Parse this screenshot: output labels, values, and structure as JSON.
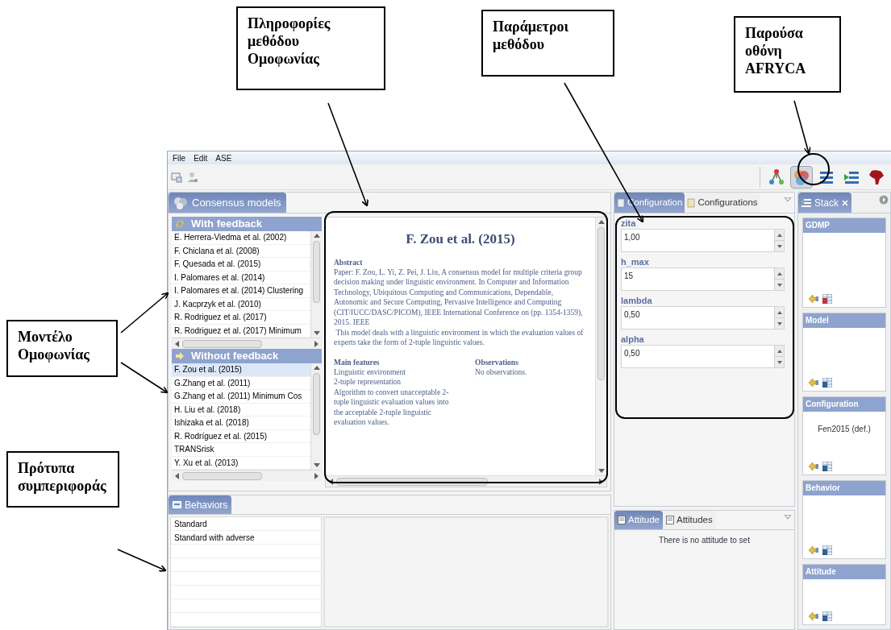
{
  "annotations": [
    {
      "text": "Πληροφορίες μεθόδου Ομοφωνίας"
    },
    {
      "text": "Παράμετροι μεθόδου"
    },
    {
      "text": "Παρούσα οθόνη AFRYCA"
    },
    {
      "text": "Μοντέλο Ομοφωνίας"
    },
    {
      "text": "Πρότυπα συμπεριφοράς"
    }
  ],
  "menu": [
    "File",
    "Edit",
    "ASE"
  ],
  "perspectives": [
    {
      "selected": false
    },
    {
      "selected": true
    },
    {
      "selected": false
    },
    {
      "selected": false
    },
    {
      "selected": false
    }
  ],
  "consensus_panel": {
    "tab": "Consensus models",
    "groups": [
      {
        "title": "With feedback",
        "items": [
          {
            "label": "E. Herrera-Viedma et al. (2002)",
            "selected": false
          },
          {
            "label": "F. Chiclana et al. (2008)",
            "selected": false
          },
          {
            "label": "F. Quesada et al. (2015)",
            "selected": false
          },
          {
            "label": "I. Palomares et al. (2014)",
            "selected": false
          },
          {
            "label": "I. Palomares et al. (2014) Clustering",
            "selected": false
          },
          {
            "label": "J. Kacprzyk et al. (2010)",
            "selected": false
          },
          {
            "label": "R. Rodriguez et al. (2017)",
            "selected": false
          },
          {
            "label": "R. Rodriguez et al. (2017) Minimum",
            "selected": false
          }
        ]
      },
      {
        "title": "Without feedback",
        "items": [
          {
            "label": "F. Zou et al. (2015)",
            "selected": true
          },
          {
            "label": "G.Zhang et al. (2011)",
            "selected": false
          },
          {
            "label": "G.Zhang et al. (2011) Minimum Cos",
            "selected": false
          },
          {
            "label": "H. Liu et al. (2018)",
            "selected": false
          },
          {
            "label": "Ishizaka et al. (2018)",
            "selected": false
          },
          {
            "label": "R. Rodríguez et al. (2015)",
            "selected": false
          },
          {
            "label": "TRANSrisk",
            "selected": false
          },
          {
            "label": "Y. Xu et al. (2013)",
            "selected": false
          }
        ]
      }
    ],
    "details": {
      "title": "F. Zou et al. (2015)",
      "abstract_heading": "Abstract",
      "abstract": [
        "Paper: F. Zou, L. Yi, Z. Pei, J. Liu, A consensus model for multiple criteria group decision making under linguistic environment. In Computer and Information Technology, Ubiquitous Computing and Communications, Dependable, Autonomic and Secure Computing, Pervasive Intelligence and Computing (CIT/IUCC/DASC/PICOM), IEEE International Conference on (pp. 1354-1359), 2015. IEEE",
        " This model deals with a linguistic environment in which the evaluation values of experts take the form of 2-tuple linguistic values."
      ],
      "features_heading": "Main features",
      "features": [
        "Linguistic environment",
        "2-tuple representation",
        "Algorithm to convert unacceptable 2-tuple linguistic evaluation values into the acceptable 2-tuple linguistic evaluation values."
      ],
      "observations_heading": "Observations",
      "observations": "No observations."
    }
  },
  "config_panel": {
    "tabs": [
      {
        "label": "Configuration",
        "selected": true
      },
      {
        "label": "Configurations",
        "selected": false
      }
    ],
    "params": [
      {
        "name": "zita",
        "value": "1,00"
      },
      {
        "name": "h_max",
        "value": "15"
      },
      {
        "name": "lambda",
        "value": "0,50"
      },
      {
        "name": "alpha",
        "value": "0,50"
      }
    ]
  },
  "stack_panel": {
    "tab": "Stack",
    "cards": [
      {
        "title": "GDMP",
        "remove_enabled": true
      },
      {
        "title": "Model",
        "remove_enabled": false
      },
      {
        "title": "Configuration",
        "value": "Fen2015 (def.)",
        "remove_enabled": false
      },
      {
        "title": "Behavior",
        "remove_enabled": false
      },
      {
        "title": "Attitude",
        "remove_enabled": false
      }
    ]
  },
  "behaviors_panel": {
    "tab": "Behaviors",
    "items": [
      "Standard",
      "Standard with adverse"
    ]
  },
  "attitude_panel": {
    "tabs": [
      {
        "label": "Attitude",
        "selected": true
      },
      {
        "label": "Attitudes",
        "selected": false
      }
    ],
    "message": "There is no attitude to set"
  }
}
